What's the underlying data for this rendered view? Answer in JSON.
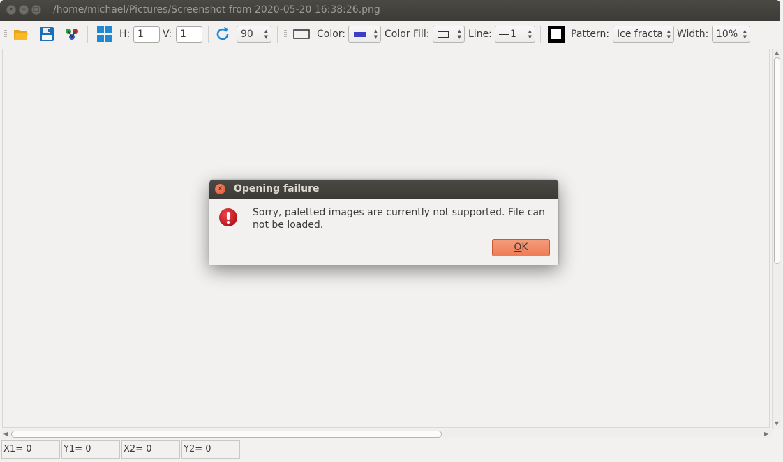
{
  "window": {
    "title": "/home/michael/Pictures/Screenshot from 2020-05-20 16:38:26.png",
    "buttons": {
      "close": "×",
      "minimize": "−",
      "maximize": "□"
    }
  },
  "toolbar": {
    "open_icon": "folder-open-icon",
    "save_icon": "floppy-save-icon",
    "effects_icon": "color-balls-icon",
    "grid_icon": "grid-icon",
    "h_label": "H:",
    "h_value": "1",
    "v_label": "V:",
    "v_value": "1",
    "rotate_icon": "rotate-clockwise-icon",
    "rotate_value": "90",
    "shape_icon": "rectangle-icon",
    "color_label": "Color:",
    "color_value": "#3b3fc4",
    "color_fill_label": "Color Fill:",
    "line_label": "Line:",
    "line_value": "1",
    "pattern_icon": "square-outline-icon",
    "pattern_label": "Pattern:",
    "pattern_value": "Ice fracta",
    "width_label": "Width:",
    "width_value": "10%"
  },
  "status": {
    "x1": "X1= 0",
    "y1": "Y1= 0",
    "x2": "X2= 0",
    "y2": "Y2= 0"
  },
  "dialog": {
    "title": "Opening failure",
    "message": "Sorry, paletted images are currently not supported. File can not be loaded.",
    "ok_mnemonic": "O",
    "ok_rest": "K",
    "icon": "error-icon"
  },
  "colors": {
    "titlebar": "#3c3b37",
    "accent_ok": "#ee7c56",
    "error_red": "#c9191e",
    "icon_blue": "#1e8ad6"
  }
}
